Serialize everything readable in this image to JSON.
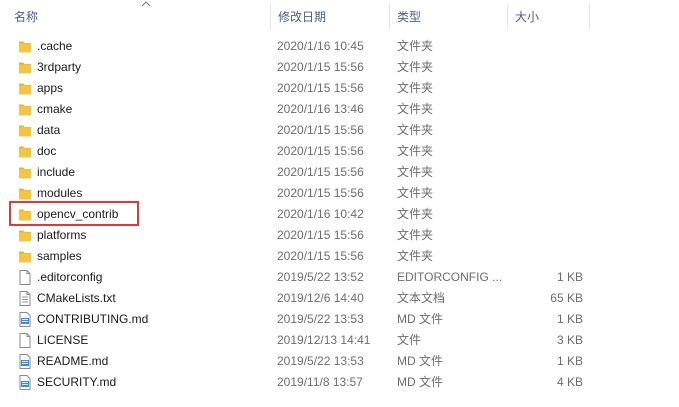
{
  "columns": {
    "name": "名称",
    "date": "修改日期",
    "type": "类型",
    "size": "大小"
  },
  "colors": {
    "folder": "#f4c542",
    "header_text": "#4d6082",
    "highlight": "#e0383d"
  },
  "rows": [
    {
      "name": ".cache",
      "date": "2020/1/16 10:45",
      "type": "文件夹",
      "size": "",
      "icon": "folder-icon"
    },
    {
      "name": "3rdparty",
      "date": "2020/1/15 15:56",
      "type": "文件夹",
      "size": "",
      "icon": "folder-icon"
    },
    {
      "name": "apps",
      "date": "2020/1/15 15:56",
      "type": "文件夹",
      "size": "",
      "icon": "folder-icon"
    },
    {
      "name": "cmake",
      "date": "2020/1/16 13:46",
      "type": "文件夹",
      "size": "",
      "icon": "folder-icon"
    },
    {
      "name": "data",
      "date": "2020/1/15 15:56",
      "type": "文件夹",
      "size": "",
      "icon": "folder-icon"
    },
    {
      "name": "doc",
      "date": "2020/1/15 15:56",
      "type": "文件夹",
      "size": "",
      "icon": "folder-icon"
    },
    {
      "name": "include",
      "date": "2020/1/15 15:56",
      "type": "文件夹",
      "size": "",
      "icon": "folder-icon"
    },
    {
      "name": "modules",
      "date": "2020/1/15 15:56",
      "type": "文件夹",
      "size": "",
      "icon": "folder-icon"
    },
    {
      "name": "opencv_contrib",
      "date": "2020/1/16 10:42",
      "type": "文件夹",
      "size": "",
      "icon": "folder-icon"
    },
    {
      "name": "platforms",
      "date": "2020/1/15 15:56",
      "type": "文件夹",
      "size": "",
      "icon": "folder-icon"
    },
    {
      "name": "samples",
      "date": "2020/1/15 15:56",
      "type": "文件夹",
      "size": "",
      "icon": "folder-icon"
    },
    {
      "name": ".editorconfig",
      "date": "2019/5/22 13:52",
      "type": "EDITORCONFIG ...",
      "size": "1 KB",
      "icon": "file-icon"
    },
    {
      "name": "CMakeLists.txt",
      "date": "2019/12/6 14:40",
      "type": "文本文档",
      "size": "65 KB",
      "icon": "text-file-icon"
    },
    {
      "name": "CONTRIBUTING.md",
      "date": "2019/5/22 13:53",
      "type": "MD 文件",
      "size": "1 KB",
      "icon": "md-file-icon"
    },
    {
      "name": "LICENSE",
      "date": "2019/12/13 14:41",
      "type": "文件",
      "size": "3 KB",
      "icon": "file-icon"
    },
    {
      "name": "README.md",
      "date": "2019/5/22 13:53",
      "type": "MD 文件",
      "size": "1 KB",
      "icon": "md-file-icon"
    },
    {
      "name": "SECURITY.md",
      "date": "2019/11/8 13:57",
      "type": "MD 文件",
      "size": "4 KB",
      "icon": "md-file-icon"
    }
  ]
}
